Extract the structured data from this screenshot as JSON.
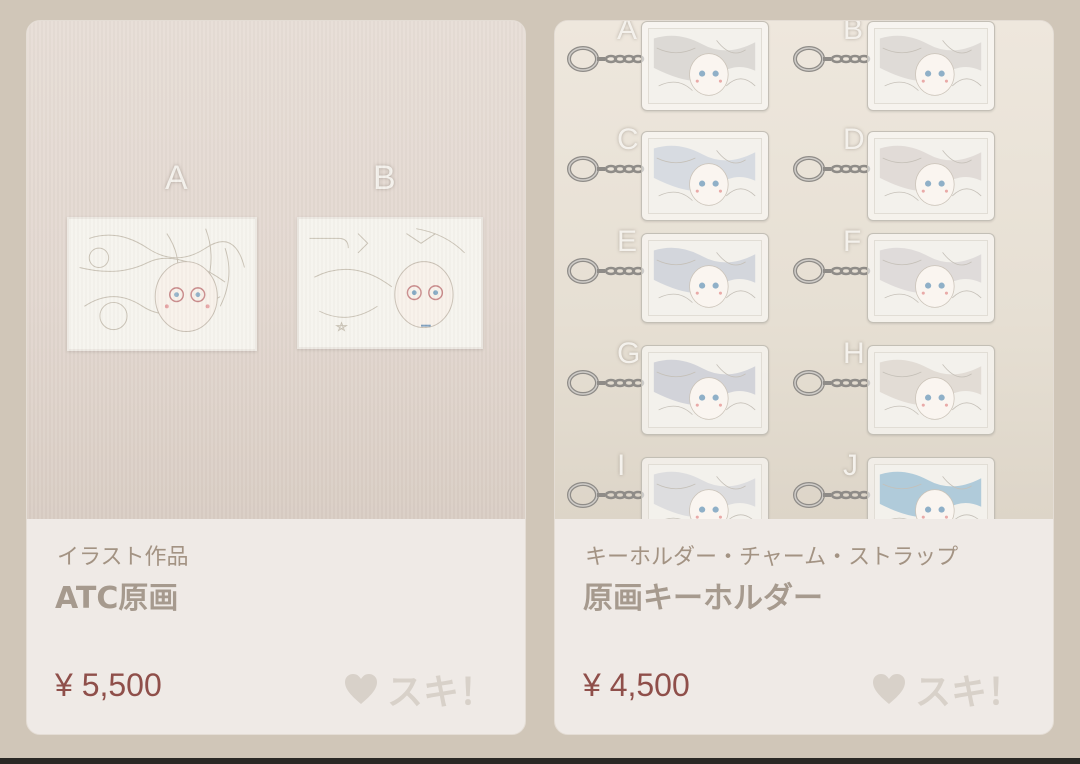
{
  "cards": [
    {
      "category": "イラスト作品",
      "title": "ATC原画",
      "price": "¥ 5,500",
      "like_label": "スキ！",
      "photo_labels": [
        "A",
        "B"
      ]
    },
    {
      "category": "キーホルダー・チャーム・ストラップ",
      "title": "原画キーホルダー",
      "price": "¥ 4,500",
      "like_label": "スキ！",
      "photo_labels": [
        "A",
        "B",
        "C",
        "D",
        "E",
        "F",
        "G",
        "H",
        "I",
        "J"
      ]
    }
  ],
  "icons": {
    "like": "heart-icon"
  },
  "colors": {
    "price": "#8f4f4a",
    "background": "#d0c6b8",
    "card": "#efeae6"
  }
}
